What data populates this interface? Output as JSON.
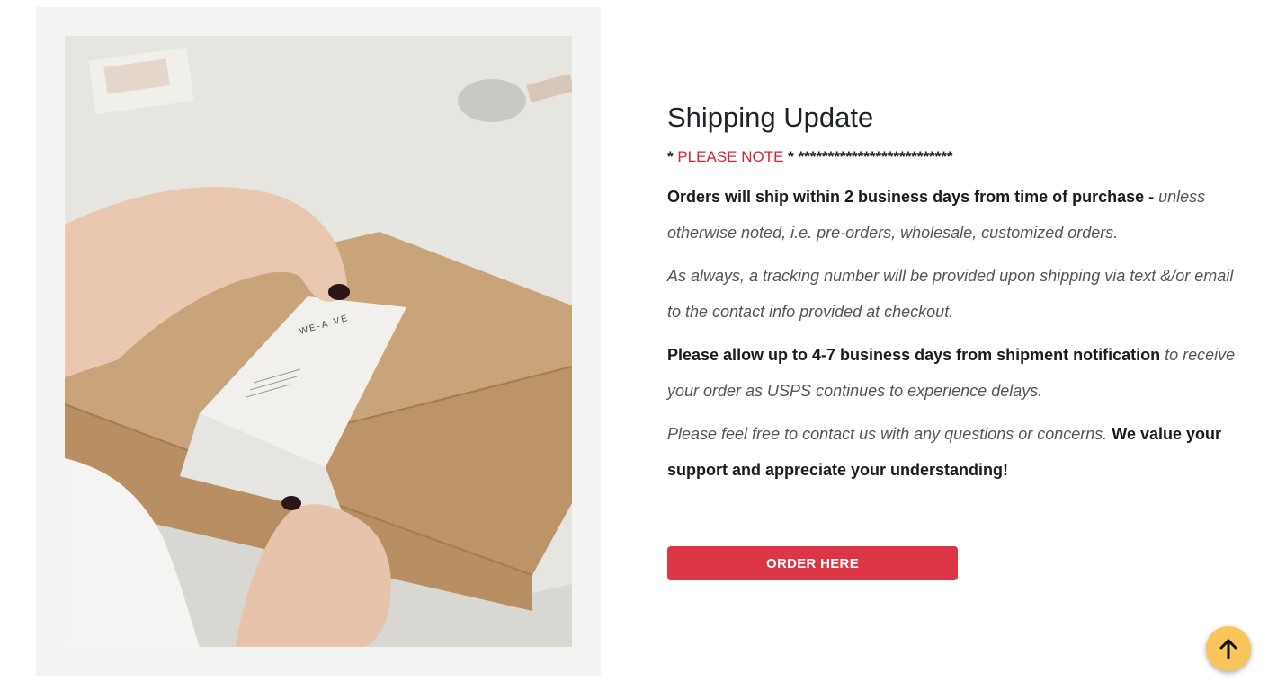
{
  "image": {
    "label_brand": "WE-A-VE"
  },
  "content": {
    "title": "Shipping Update",
    "note": {
      "prefix": "* ",
      "highlight": "PLEASE NOTE",
      "suffix": " * **************************"
    },
    "paragraphs": {
      "p1_bold": "Orders will ship within 2 business days from time of purchase - ",
      "p1_italic": "unless otherwise noted, i.e. pre-orders, wholesale, customized orders.",
      "p2_italic": "As always, a tracking number will be provided upon shipping via text &/or email to the contact info provided at checkout.",
      "p3_bold": "Please allow up to 4-7 business days from shipment notification ",
      "p3_italic": "to receive your order as USPS continues to experience delays.",
      "p4_italic": "Please feel free to contact us with any questions or concerns. ",
      "p4_bold": "We value your support and appreciate your understanding!"
    },
    "order_button_label": "ORDER HERE"
  },
  "scroll_top": {
    "icon": "arrow-up-icon"
  },
  "colors": {
    "accent_red": "#dc3545",
    "note_red": "#dc2233",
    "scroll_button": "#f7c55a"
  }
}
